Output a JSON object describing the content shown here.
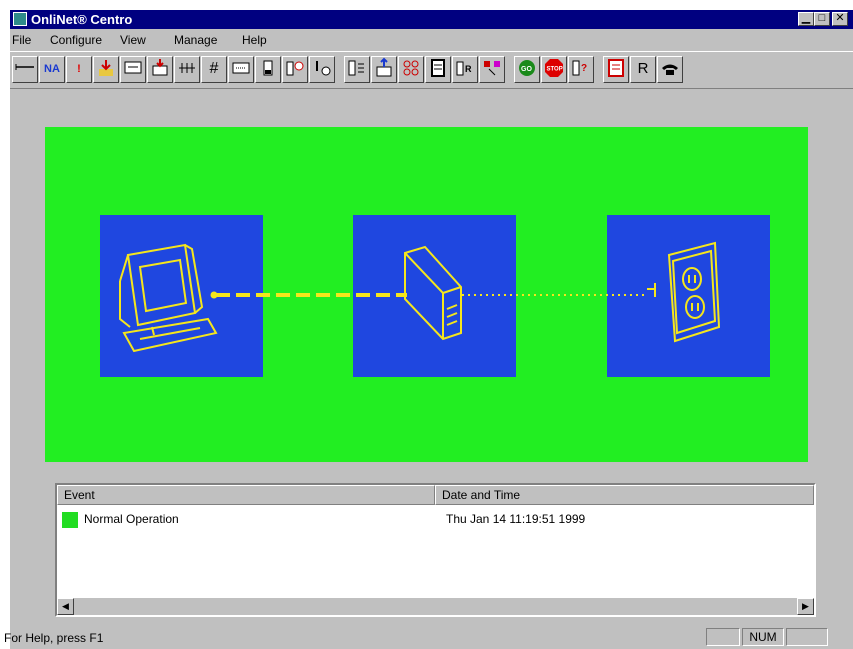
{
  "window": {
    "title": "OnliNet® Centro",
    "controls": {
      "minimize": "▁",
      "maximize": "□",
      "close": "✕"
    }
  },
  "menu": [
    "File",
    "Configure",
    "View",
    "Manage",
    "Help"
  ],
  "toolbar": {
    "buttons": [
      "line-icon",
      "na-icon",
      "alert-icon",
      "download-icon",
      "card-icon",
      "print-icon",
      "grid-lines-icon",
      "hash-icon",
      "keypad-icon",
      "meter-icon",
      "timer-icon",
      "clock-icon",
      "list-icon",
      "export-icon",
      "matrix-icon",
      "document-icon",
      "restart-icon",
      "flag-icon",
      "go-icon",
      "stop-icon",
      "help-query-icon",
      "calendar-icon",
      "reset-icon",
      "phone-icon"
    ],
    "labels": {
      "na": "NA",
      "reset": "R",
      "go": "GO",
      "stop": "STOP"
    }
  },
  "diagram": {
    "devices": [
      "computer-icon",
      "ups-device-icon",
      "wall-outlet-icon"
    ],
    "colors": {
      "background": "#22ee22",
      "box": "#1f47e0",
      "line": "#f5e61c"
    }
  },
  "events": {
    "columns": [
      "Event",
      "Date and Time"
    ],
    "rows": [
      {
        "event": "Normal Operation",
        "datetime": "Thu Jan 14 11:19:51 1999",
        "status_color": "#22dd22"
      }
    ]
  },
  "status": {
    "help_text": "For Help, press F1",
    "panes": [
      "",
      "NUM",
      ""
    ]
  }
}
